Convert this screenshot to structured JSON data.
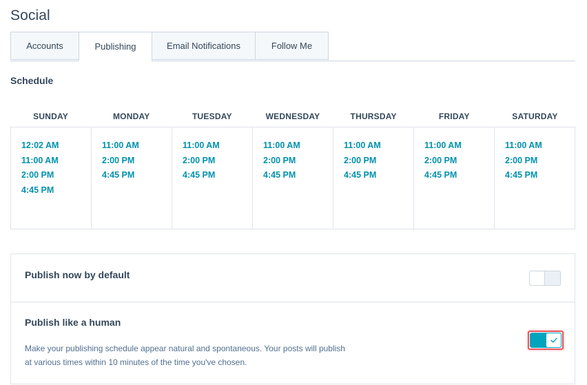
{
  "page": {
    "title": "Social"
  },
  "tabs": [
    {
      "label": "Accounts",
      "active": false
    },
    {
      "label": "Publishing",
      "active": true
    },
    {
      "label": "Email Notifications",
      "active": false
    },
    {
      "label": "Follow Me",
      "active": false
    }
  ],
  "schedule": {
    "heading": "Schedule",
    "days": [
      {
        "name": "SUNDAY",
        "times": [
          "12:02 AM",
          "11:00 AM",
          "2:00 PM",
          "4:45 PM"
        ]
      },
      {
        "name": "MONDAY",
        "times": [
          "11:00 AM",
          "2:00 PM",
          "4:45 PM"
        ]
      },
      {
        "name": "TUESDAY",
        "times": [
          "11:00 AM",
          "2:00 PM",
          "4:45 PM"
        ]
      },
      {
        "name": "WEDNESDAY",
        "times": [
          "11:00 AM",
          "2:00 PM",
          "4:45 PM"
        ]
      },
      {
        "name": "THURSDAY",
        "times": [
          "11:00 AM",
          "2:00 PM",
          "4:45 PM"
        ]
      },
      {
        "name": "FRIDAY",
        "times": [
          "11:00 AM",
          "2:00 PM",
          "4:45 PM"
        ]
      },
      {
        "name": "SATURDAY",
        "times": [
          "11:00 AM",
          "2:00 PM",
          "4:45 PM"
        ]
      }
    ]
  },
  "settings": {
    "publish_now": {
      "title": "Publish now by default",
      "enabled": false
    },
    "publish_like_human": {
      "title": "Publish like a human",
      "description_line1": "Make your publishing schedule appear natural and spontaneous. Your posts will publish",
      "description_line2": "at various times within 10 minutes of the time you've chosen.",
      "enabled": true
    }
  },
  "colors": {
    "accent": "#00a4bd",
    "time_text": "#0091ae",
    "highlight": "#f2545b",
    "text": "#33475b"
  },
  "icons": {
    "toggle_check": "check-icon"
  }
}
